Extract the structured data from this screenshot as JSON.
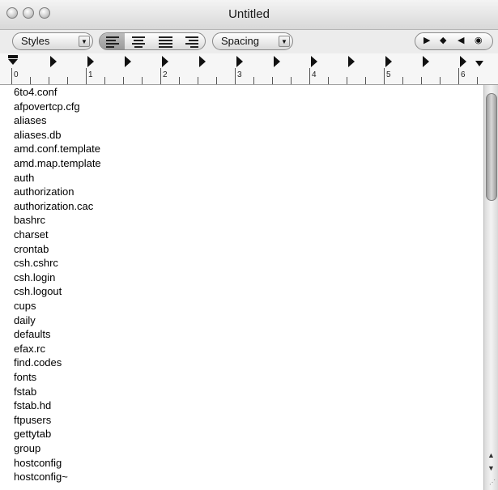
{
  "window": {
    "title": "Untitled"
  },
  "toolbar": {
    "styles_label": "Styles",
    "spacing_label": "Spacing",
    "alignment_selected": "left"
  },
  "ruler": {
    "numbers": [
      "0",
      "1",
      "2",
      "3",
      "4",
      "5",
      "6"
    ]
  },
  "files": [
    "6to4.conf",
    "afpovertcp.cfg",
    "aliases",
    "aliases.db",
    "amd.conf.template",
    "amd.map.template",
    "auth",
    "authorization",
    "authorization.cac",
    "bashrc",
    "charset",
    "crontab",
    "csh.cshrc",
    "csh.login",
    "csh.logout",
    "cups",
    "daily",
    "defaults",
    "efax.rc",
    "find.codes",
    "fonts",
    "fstab",
    "fstab.hd",
    "ftpusers",
    "gettytab",
    "group",
    "hostconfig",
    "hostconfig~"
  ]
}
